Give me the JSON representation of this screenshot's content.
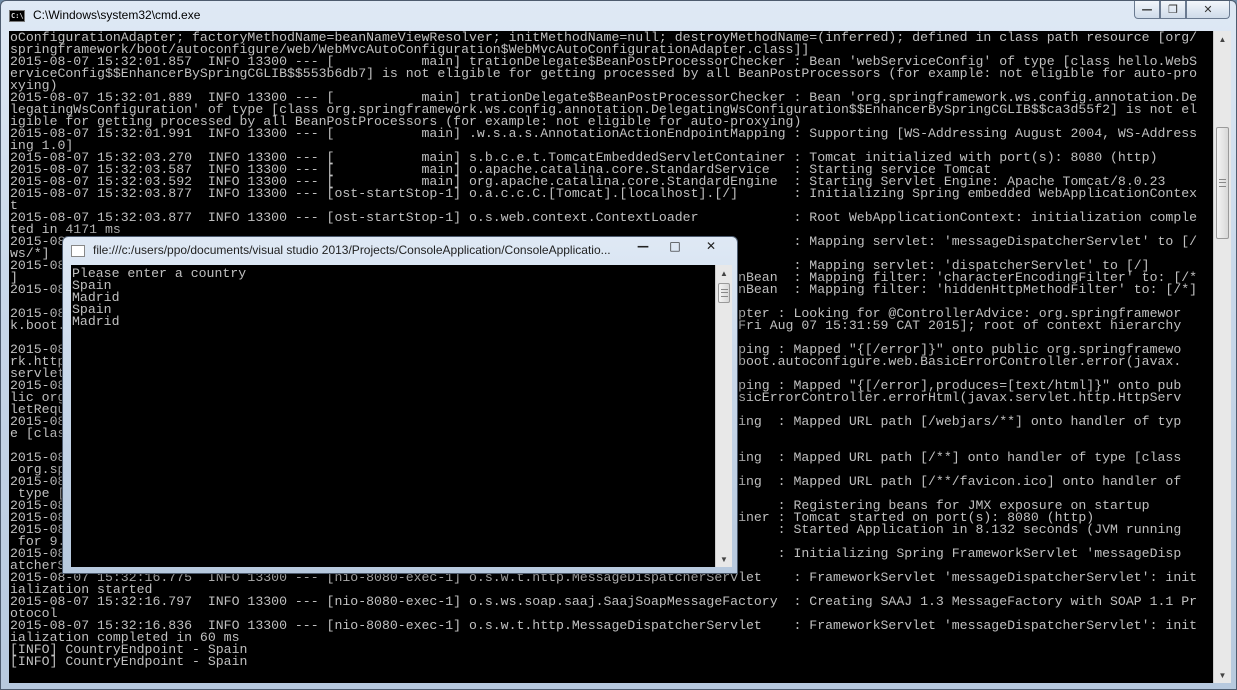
{
  "main_window": {
    "title": "C:\\Windows\\system32\\cmd.exe",
    "icon": "cmd-icon",
    "console_lines": [
      "oConfigurationAdapter; factoryMethodName=beanNameViewResolver; initMethodName=null; destroyMethodName=(inferred); defined in class path resource [org/",
      "springframework/boot/autoconfigure/web/WebMvcAutoConfiguration$WebMvcAutoConfigurationAdapter.class]]",
      "2015-08-07 15:32:01.857  INFO 13300 --- [           main] trationDelegate$BeanPostProcessorChecker : Bean 'webServiceConfig' of type [class hello.WebS",
      "erviceConfig$$EnhancerBySpringCGLIB$$553b6db7] is not eligible for getting processed by all BeanPostProcessors (for example: not eligible for auto-pro",
      "xying)",
      "2015-08-07 15:32:01.889  INFO 13300 --- [           main] trationDelegate$BeanPostProcessorChecker : Bean 'org.springframework.ws.config.annotation.De",
      "legatingWsConfiguration' of type [class org.springframework.ws.config.annotation.DelegatingWsConfiguration$$EnhancerBySpringCGLIB$$ca3d55f2] is not el",
      "igible for getting processed by all BeanPostProcessors (for example: not eligible for auto-proxying)",
      "2015-08-07 15:32:01.991  INFO 13300 --- [           main] .w.s.a.s.AnnotationActionEndpointMapping : Supporting [WS-Addressing August 2004, WS-Address",
      "ing 1.0]",
      "2015-08-07 15:32:03.270  INFO 13300 --- [           main] s.b.c.e.t.TomcatEmbeddedServletContainer : Tomcat initialized with port(s): 8080 (http)",
      "2015-08-07 15:32:03.587  INFO 13300 --- [           main] o.apache.catalina.core.StandardService   : Starting service Tomcat",
      "2015-08-07 15:32:03.592  INFO 13300 --- [           main] org.apache.catalina.core.StandardEngine  : Starting Servlet Engine: Apache Tomcat/8.0.23",
      "2015-08-07 15:32:03.877  INFO 13300 --- [ost-startStop-1] o.a.c.c.C.[Tomcat].[localhost].[/]       : Initializing Spring embedded WebApplicationContex",
      "t",
      "2015-08-07 15:32:03.877  INFO 13300 --- [ost-startStop-1] o.s.web.context.ContextLoader            : Root WebApplicationContext: initialization comple",
      "ted in 4171 ms",
      "2015-08-                                                                                           : Mapping servlet: 'messageDispatcherServlet' to [/",
      "ws/*]",
      "2015-08-                                                                                           : Mapping servlet: 'dispatcherServlet' to [/]",
      "]                                                                                          onBean  : Mapping filter: 'characterEncodingFilter' to: [/*",
      "2015-08-                                                                                   onBean  : Mapping filter: 'hiddenHttpMethodFilter' to: [/*]",
      "",
      "2015-08-                                                                                 Adapter : Looking for @ControllerAdvice: org.springframewor",
      "k.boot.                                                                                  e [Fri Aug 07 15:31:59 CAT 2015]; root of context hierarchy",
      "",
      "2015-08-                                                                                 Mapping : Mapped \"{[/error]}\" onto public org.springframewo",
      "rk.http                                                                                  rk.boot.autoconfigure.web.BasicErrorController.error(javax.",
      "servlet",
      "2015-08-                                                                                 Mapping : Mapped \"{[/error],produces=[text/html]}\" onto pub",
      "lic org                                                                                  .BasicErrorController.errorHtml(javax.servlet.http.HttpServ",
      "letRequ",
      "2015-08-                                                                                 apping  : Mapped URL path [/webjars/**] onto handler of typ",
      "e [clas",
      "",
      "2015-08-                                                                                 apping  : Mapped URL path [/**] onto handler of type [class",
      " org.sp",
      "2015-08-                                                                                 apping  : Mapped URL path [/**/favicon.ico] onto handler of",
      " type [",
      "2015-08-                                                                                         : Registering beans for JMX exposure on startup",
      "2015-08-                                                                                 ntainer : Tomcat started on port(s): 8080 (http)",
      "2015-08-                                                                                         : Started Application in 8.132 seconds (JVM running",
      " for 9.",
      "2015-08-                                                                                 ]       : Initializing Spring FrameworkServlet 'messageDisp",
      "atcherS",
      "2015-08-07 15:32:16.775  INFO 13300 --- [nio-8080-exec-1] o.s.w.t.http.MessageDispatcherServlet    : FrameworkServlet 'messageDispatcherServlet': init",
      "ialization started",
      "2015-08-07 15:32:16.797  INFO 13300 --- [nio-8080-exec-1] o.s.ws.soap.saaj.SaajSoapMessageFactory  : Creating SAAJ 1.3 MessageFactory with SOAP 1.1 Pr",
      "otocol",
      "2015-08-07 15:32:16.836  INFO 13300 --- [nio-8080-exec-1] o.s.w.t.http.MessageDispatcherServlet    : FrameworkServlet 'messageDispatcherServlet': init",
      "ialization completed in 60 ms",
      "[INFO] CountryEndpoint - Spain",
      "[INFO] CountryEndpoint - Spain"
    ]
  },
  "popup_window": {
    "title": "file:///c:/users/ppo/documents/visual studio 2013/Projects/ConsoleApplication/ConsoleApplicatio...",
    "icon": "blank-window-icon",
    "console_lines": [
      "Please enter a country",
      "Spain",
      "Madrid",
      "Spain",
      "Madrid"
    ]
  }
}
